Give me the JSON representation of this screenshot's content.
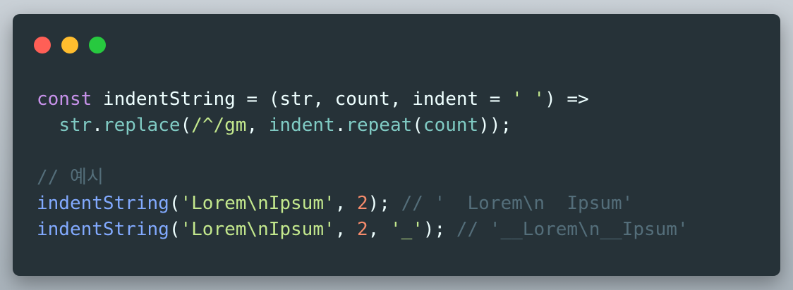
{
  "window": {
    "controls": [
      {
        "name": "close",
        "color": "#ff5f56"
      },
      {
        "name": "minimize",
        "color": "#ffbd2e"
      },
      {
        "name": "maximize",
        "color": "#27c93f"
      }
    ]
  },
  "code": {
    "lines": [
      [
        {
          "text": "const",
          "color": "#c792ea"
        },
        {
          "text": " indentString = (str, count, indent = ",
          "color": "#eeffff"
        },
        {
          "text": "' '",
          "color": "#c3e88d"
        },
        {
          "text": ") =>",
          "color": "#eeffff"
        }
      ],
      [
        {
          "text": "  ",
          "color": "#eeffff"
        },
        {
          "text": "str",
          "color": "#80cbc4"
        },
        {
          "text": ".",
          "color": "#eeffff"
        },
        {
          "text": "replace",
          "color": "#80cbc4"
        },
        {
          "text": "(",
          "color": "#eeffff"
        },
        {
          "text": "/^/gm",
          "color": "#c3e88d"
        },
        {
          "text": ", ",
          "color": "#eeffff"
        },
        {
          "text": "indent",
          "color": "#80cbc4"
        },
        {
          "text": ".",
          "color": "#eeffff"
        },
        {
          "text": "repeat",
          "color": "#80cbc4"
        },
        {
          "text": "(",
          "color": "#eeffff"
        },
        {
          "text": "count",
          "color": "#80cbc4"
        },
        {
          "text": "));",
          "color": "#eeffff"
        }
      ],
      [],
      [
        {
          "text": "// 예시",
          "color": "#546e7a"
        }
      ],
      [
        {
          "text": "indentString",
          "color": "#82aaff"
        },
        {
          "text": "(",
          "color": "#eeffff"
        },
        {
          "text": "'Lorem\\nIpsum'",
          "color": "#c3e88d"
        },
        {
          "text": ", ",
          "color": "#eeffff"
        },
        {
          "text": "2",
          "color": "#f78c6c"
        },
        {
          "text": "); ",
          "color": "#eeffff"
        },
        {
          "text": "// '  Lorem\\n  Ipsum'",
          "color": "#546e7a"
        }
      ],
      [
        {
          "text": "indentString",
          "color": "#82aaff"
        },
        {
          "text": "(",
          "color": "#eeffff"
        },
        {
          "text": "'Lorem\\nIpsum'",
          "color": "#c3e88d"
        },
        {
          "text": ", ",
          "color": "#eeffff"
        },
        {
          "text": "2",
          "color": "#f78c6c"
        },
        {
          "text": ", ",
          "color": "#eeffff"
        },
        {
          "text": "'_'",
          "color": "#c3e88d"
        },
        {
          "text": "); ",
          "color": "#eeffff"
        },
        {
          "text": "// '__Lorem\\n__Ipsum'",
          "color": "#546e7a"
        }
      ]
    ]
  }
}
